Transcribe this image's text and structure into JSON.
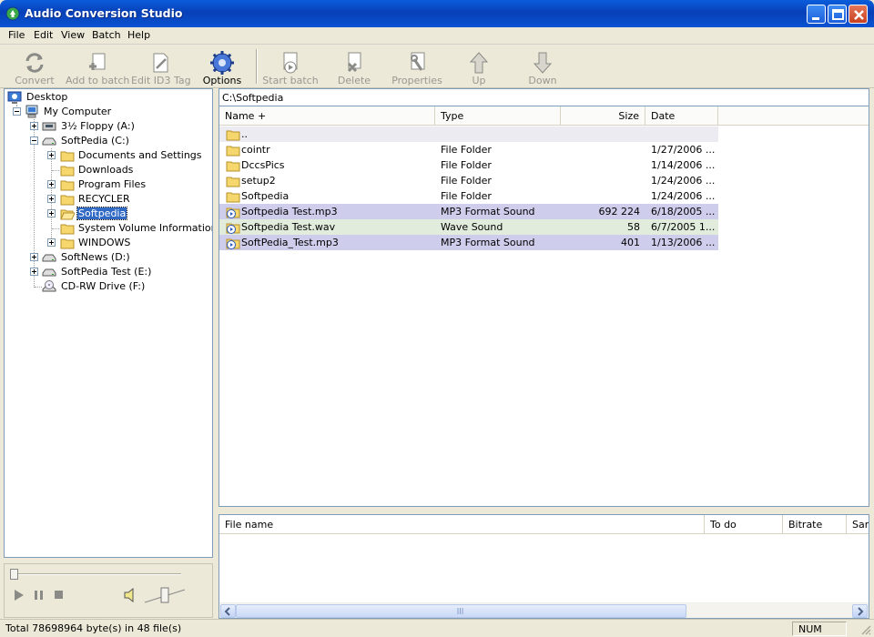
{
  "window": {
    "title": "Audio Conversion Studio"
  },
  "menu": [
    "File",
    "Edit",
    "View",
    "Batch",
    "Help"
  ],
  "toolbar": [
    {
      "label": "Convert",
      "icon": "convert-icon",
      "enabled": false
    },
    {
      "label": "Add to batch",
      "icon": "add-to-batch-icon",
      "enabled": false
    },
    {
      "label": "Edit ID3 Tag",
      "icon": "edit-tag-icon",
      "enabled": false
    },
    {
      "label": "Options",
      "icon": "options-gear-icon",
      "enabled": true
    },
    {
      "label": "Start batch",
      "icon": "start-batch-icon",
      "enabled": false
    },
    {
      "label": "Delete",
      "icon": "delete-icon",
      "enabled": false
    },
    {
      "label": "Properties",
      "icon": "properties-icon",
      "enabled": false
    },
    {
      "label": "Up",
      "icon": "arrow-up-icon",
      "enabled": false
    },
    {
      "label": "Down",
      "icon": "arrow-down-icon",
      "enabled": false
    }
  ],
  "tree": [
    {
      "label": "Desktop",
      "icon": "desktop-icon",
      "level": 0
    },
    {
      "label": "My Computer",
      "icon": "computer-icon",
      "level": 1,
      "expander": "minus"
    },
    {
      "label": "3½ Floppy (A:)",
      "icon": "floppy-icon",
      "level": 2,
      "expander": "plus"
    },
    {
      "label": "SoftPedia (C:)",
      "icon": "drive-icon",
      "level": 2,
      "expander": "minus"
    },
    {
      "label": "Documents and Settings",
      "icon": "folder-icon",
      "level": 3,
      "expander": "plus"
    },
    {
      "label": "Downloads",
      "icon": "folder-icon",
      "level": 3
    },
    {
      "label": "Program Files",
      "icon": "folder-icon",
      "level": 3,
      "expander": "plus"
    },
    {
      "label": "RECYCLER",
      "icon": "folder-icon",
      "level": 3,
      "expander": "plus"
    },
    {
      "label": "Softpedia",
      "icon": "folder-open-icon",
      "level": 3,
      "expander": "plus",
      "selected": true
    },
    {
      "label": "System Volume Information",
      "icon": "folder-icon",
      "level": 3
    },
    {
      "label": "WINDOWS",
      "icon": "folder-icon",
      "level": 3,
      "expander": "plus"
    },
    {
      "label": "SoftNews (D:)",
      "icon": "drive-icon",
      "level": 2,
      "expander": "plus"
    },
    {
      "label": "SoftPedia Test (E:)",
      "icon": "drive-icon",
      "level": 2,
      "expander": "plus"
    },
    {
      "label": "CD-RW Drive (F:)",
      "icon": "cdrom-icon",
      "level": 2
    }
  ],
  "path": "C:\\Softpedia",
  "file_columns": [
    "Name +",
    "Type",
    "Size",
    "Date"
  ],
  "files": [
    {
      "name": "..",
      "type": "",
      "size": "",
      "date": "",
      "kind": "folder",
      "bg": "#ecebf2"
    },
    {
      "name": "cointr",
      "type": "File Folder",
      "size": "",
      "date": "1/27/2006 ...",
      "kind": "folder",
      "bg": "#ffffff"
    },
    {
      "name": "DccsPics",
      "type": "File Folder",
      "size": "",
      "date": "1/14/2006 ...",
      "kind": "folder",
      "bg": "#ffffff"
    },
    {
      "name": "setup2",
      "type": "File Folder",
      "size": "",
      "date": "1/24/2006 ...",
      "kind": "folder",
      "bg": "#ffffff"
    },
    {
      "name": "Softpedia",
      "type": "File Folder",
      "size": "",
      "date": "1/24/2006 ...",
      "kind": "folder",
      "bg": "#ffffff"
    },
    {
      "name": "Softpedia Test.mp3",
      "type": "MP3 Format Sound",
      "size": "692 224",
      "date": "6/18/2005 ...",
      "kind": "audio",
      "bg": "#cfcdec"
    },
    {
      "name": "Softpedia Test.wav",
      "type": "Wave Sound",
      "size": "58",
      "date": "6/7/2005 1...",
      "kind": "audio",
      "bg": "#e1ecdc"
    },
    {
      "name": "SoftPedia_Test.mp3",
      "type": "MP3 Format Sound",
      "size": "401",
      "date": "1/13/2006 ...",
      "kind": "audio",
      "bg": "#cfcdec"
    }
  ],
  "batch_columns": [
    "File name",
    "To do",
    "Bitrate",
    "Sam"
  ],
  "status": {
    "text": "Total 78698964 byte(s) in 48 file(s)",
    "num": "NUM"
  },
  "colors": {
    "title_bar": "#0a53d2",
    "selection": "#316ac5",
    "mp3_row": "#cfcdec",
    "wav_row": "#e1ecdc"
  }
}
